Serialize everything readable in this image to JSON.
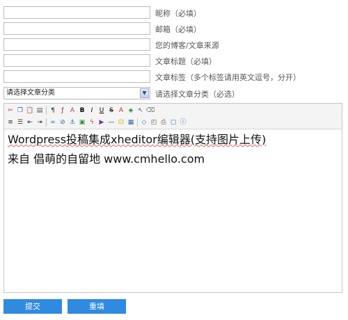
{
  "form": {
    "fields": [
      {
        "label": "昵称（必填）",
        "value": ""
      },
      {
        "label": "邮箱（必填）",
        "value": ""
      },
      {
        "label": "您的博客/文章来源",
        "value": ""
      },
      {
        "label": "文章标题（必填）",
        "value": ""
      },
      {
        "label": "文章标签（多个标签请用英文逗号，分开）",
        "value": ""
      }
    ],
    "category": {
      "selected": "请选择文章分类",
      "label": "请选择文章分类（必选）"
    }
  },
  "editor": {
    "toolbar": {
      "row1": [
        "cut-icon",
        "copy-icon",
        "paste-icon",
        "paste-text-icon",
        "block-format-icon",
        "font-family-icon",
        "font-size-icon",
        "bold-icon",
        "italic-icon",
        "underline-icon",
        "strikethrough-icon",
        "font-color-icon",
        "background-color-icon",
        "select-all-icon",
        "remove-format-icon"
      ],
      "row2": [
        "align-icon",
        "list-icon",
        "outdent-icon",
        "indent-icon",
        "link-icon",
        "unlink-icon",
        "anchor-icon",
        "image-icon",
        "flash-icon",
        "media-icon",
        "horizontal-rule-icon",
        "emoticon-icon",
        "table-icon",
        "source-icon",
        "preview-icon",
        "print-icon",
        "fullscreen-icon",
        "about-icon"
      ],
      "glyphs": {
        "cut-icon": "✂",
        "copy-icon": "❐",
        "paste-icon": "📋",
        "paste-text-icon": "▤",
        "block-format-icon": "¶",
        "font-family-icon": "ƒ",
        "font-size-icon": "A",
        "bold-icon": "B",
        "italic-icon": "I",
        "underline-icon": "U",
        "strikethrough-icon": "S",
        "font-color-icon": "A",
        "background-color-icon": "◈",
        "select-all-icon": "↖",
        "remove-format-icon": "⌫",
        "align-icon": "≡",
        "list-icon": "☰",
        "outdent-icon": "⇤",
        "indent-icon": "⇥",
        "link-icon": "∞",
        "unlink-icon": "⊘",
        "anchor-icon": "⚓",
        "image-icon": "▣",
        "flash-icon": "ϟ",
        "media-icon": "▶",
        "horizontal-rule-icon": "—",
        "emoticon-icon": "☺",
        "table-icon": "▦",
        "source-icon": "◇",
        "preview-icon": "◰",
        "print-icon": "⎙",
        "fullscreen-icon": "▢",
        "about-icon": "ⓘ"
      },
      "colors": {
        "cut-icon": "#c0392b",
        "copy-icon": "#2c6fbb",
        "paste-icon": "#b8860b",
        "paste-text-icon": "#555",
        "block-format-icon": "#444",
        "font-family-icon": "#7a2e2e",
        "font-size-icon": "#a44",
        "bold-icon": "#000",
        "italic-icon": "#000",
        "underline-icon": "#000",
        "strikethrough-icon": "#000",
        "font-color-icon": "#d22",
        "background-color-icon": "#2e7d32",
        "select-all-icon": "#555",
        "remove-format-icon": "#777",
        "align-icon": "#333",
        "list-icon": "#333",
        "outdent-icon": "#333",
        "indent-icon": "#333",
        "link-icon": "#3a65a8",
        "unlink-icon": "#3a65a8",
        "anchor-icon": "#3a65a8",
        "image-icon": "#3d8b3d",
        "flash-icon": "#c0392b",
        "media-icon": "#6a3d9a",
        "horizontal-rule-icon": "#333",
        "emoticon-icon": "#d4a800",
        "table-icon": "#3a65a8",
        "source-icon": "#2c6fbb",
        "preview-icon": "#555",
        "print-icon": "#555",
        "fullscreen-icon": "#2c6fbb",
        "about-icon": "#2c6fbb"
      }
    },
    "content": {
      "line1": "Wordpress投稿集成xheditor编辑器(支持图片上传)",
      "line2": "来自 倡萌的自留地  www.cmhello.com"
    }
  },
  "buttons": {
    "submit": "提交",
    "reset": "重填"
  },
  "colors": {
    "accent": "#2f8ae0",
    "field_border": "#b9b9b9"
  }
}
